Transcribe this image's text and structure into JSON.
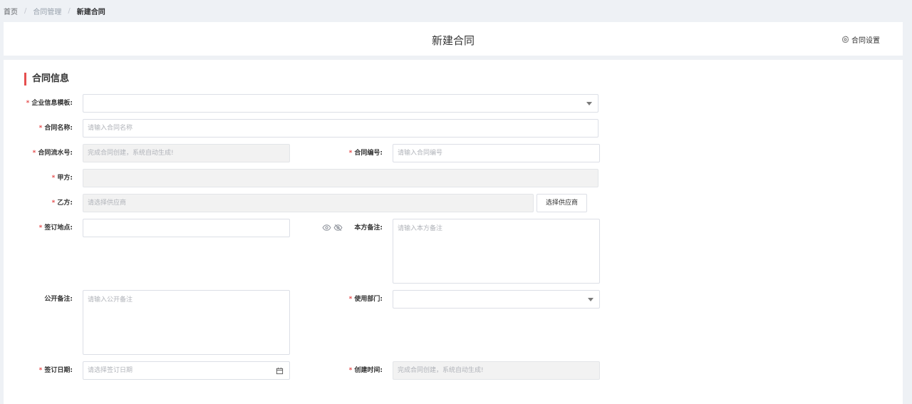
{
  "breadcrumb": {
    "home": "首页",
    "parent": "合同管理",
    "current": "新建合同",
    "separator": "/"
  },
  "header": {
    "title": "新建合同",
    "settings_label": "合同设置",
    "settings_icon": "gear-icon"
  },
  "section": {
    "title": "合同信息",
    "accent_color": "#e54f4f"
  },
  "form": {
    "required_mark": "*",
    "template": {
      "label": "企业信息模板:",
      "value": ""
    },
    "name": {
      "label": "合同名称:",
      "placeholder": "请输入合同名称"
    },
    "serial": {
      "label": "合同流水号:",
      "placeholder": "完成合同创建，系统自动生成!"
    },
    "number": {
      "label": "合同编号:",
      "placeholder": "请输入合同编号"
    },
    "party_a": {
      "label": "甲方:",
      "value": ""
    },
    "party_b": {
      "label": "乙方:",
      "placeholder": "请选择供应商",
      "button": "选择供应商"
    },
    "location": {
      "label": "签订地点:",
      "value": ""
    },
    "own_note": {
      "label": "本方备注:",
      "placeholder": "请输入本方备注"
    },
    "public_note": {
      "label": "公开备注:",
      "placeholder": "请输入公开备注"
    },
    "department": {
      "label": "使用部门:",
      "value": ""
    },
    "sign_date": {
      "label": "签订日期:",
      "placeholder": "请选择签订日期"
    },
    "created_time": {
      "label": "创建时间:",
      "placeholder": "完成合同创建，系统自动生成!"
    }
  }
}
